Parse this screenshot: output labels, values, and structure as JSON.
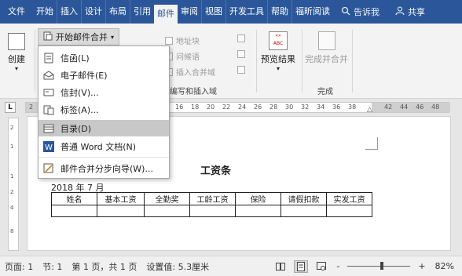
{
  "ribbon_tabs": [
    "文件",
    "开始",
    "插入",
    "设计",
    "布局",
    "引用",
    "邮件",
    "审阅",
    "视图",
    "开发工具",
    "帮助",
    "福昕阅读"
  ],
  "active_tab_index": 6,
  "search_placeholder": "告诉我",
  "share_label": "共享",
  "ribbon": {
    "create_label": "创建",
    "start_mail_merge_label": "开始邮件合并",
    "address_block": "地址块",
    "greeting_line": "问候语",
    "insert_merge_field": "插入合并域",
    "write_insert_group": "编写和插入域",
    "preview_results": "预览结果",
    "finish_merge": "完成并合并",
    "finish_group": "完成",
    "abc_badge": "ABC"
  },
  "dropdown_items": [
    {
      "label": "信函(L)",
      "icon": "letter-icon"
    },
    {
      "label": "电子邮件(E)",
      "icon": "email-icon"
    },
    {
      "label": "信封(V)...",
      "icon": "envelope-icon"
    },
    {
      "label": "标签(A)...",
      "icon": "label-icon"
    },
    {
      "label": "目录(D)",
      "icon": "directory-icon"
    },
    {
      "label": "普通 Word 文档(N)",
      "icon": "word-doc-icon"
    },
    {
      "label": "邮件合并分步向导(W)...",
      "icon": "wizard-icon"
    }
  ],
  "selected_dropdown_index": 4,
  "ruler_ticks": [
    "2",
    "16",
    "18",
    "20",
    "22",
    "24",
    "26",
    "28",
    "30",
    "32",
    "34",
    "36",
    "38",
    "42",
    "44",
    "46",
    "48"
  ],
  "ruler_corner": "L",
  "vruler_ticks": [
    "2",
    "1",
    "1",
    "2",
    "4",
    "8"
  ],
  "document": {
    "title": "工资条",
    "date": "2018 年 7 月",
    "table_headers": [
      "姓名",
      "基本工资",
      "全勤奖",
      "工龄工资",
      "保险",
      "请假扣款",
      "实发工资"
    ]
  },
  "statusbar": {
    "page": "页面: 1",
    "section": "节: 1",
    "pages": "第 1 页，共 1 页",
    "setting": "设置值: 5.3厘米",
    "zoom": "82%",
    "zoom_minus": "-",
    "zoom_plus": "+"
  },
  "colors": {
    "tab_bar": "#2b579a",
    "ribbon_bg": "#f3f3f3",
    "selection": "#c8c8c8"
  }
}
